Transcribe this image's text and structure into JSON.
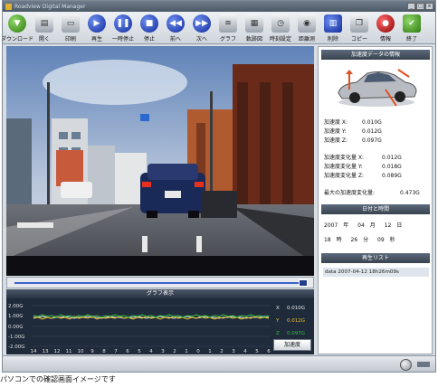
{
  "app": {
    "title": "Roadview Digital Manager"
  },
  "toolbar": {
    "items": [
      {
        "label": "ダウンロード",
        "icon": "download-icon"
      },
      {
        "label": "開く",
        "icon": "open-icon"
      },
      {
        "label": "印刷",
        "icon": "print-icon"
      },
      {
        "label": "再生",
        "icon": "play-icon"
      },
      {
        "label": "一時停止",
        "icon": "pause-icon"
      },
      {
        "label": "停止",
        "icon": "stop-icon"
      },
      {
        "label": "前へ",
        "icon": "previous-icon"
      },
      {
        "label": "次へ",
        "icon": "next-icon"
      },
      {
        "label": "グラフ",
        "icon": "graph-icon"
      },
      {
        "label": "軌跡図",
        "icon": "track-icon"
      },
      {
        "label": "時刻設定",
        "icon": "clock-icon"
      },
      {
        "label": "距離測",
        "icon": "distance-icon"
      },
      {
        "label": "削除",
        "icon": "delete-icon"
      },
      {
        "label": "コピー",
        "icon": "copy-icon"
      },
      {
        "label": "情報",
        "icon": "info-icon"
      },
      {
        "label": "終了",
        "icon": "exit-icon"
      }
    ]
  },
  "graph": {
    "title": "グラフ表示",
    "y_labels": [
      "2.00G",
      "1.00G",
      "0.00G",
      "-1.00G",
      "-2.00G"
    ],
    "x_labels": [
      "14",
      "13",
      "12",
      "11",
      "10",
      "9",
      "8",
      "7",
      "6",
      "5",
      "4",
      "3",
      "2",
      "1",
      "0",
      "1",
      "2",
      "3",
      "4",
      "5",
      "6"
    ],
    "legend": [
      {
        "axis": "X",
        "value": "0.010G",
        "color": "#e8e8e8"
      },
      {
        "axis": "Y",
        "value": "0.012G",
        "color": "#f0c030"
      },
      {
        "axis": "Z",
        "value": "0.097G",
        "color": "#30c040"
      }
    ],
    "button_label": "加速度"
  },
  "sensor": {
    "title": "加速度データの情報",
    "rows": [
      {
        "label": "加速度 X:",
        "value": "0.010G"
      },
      {
        "label": "加速度 Y:",
        "value": "0.012G"
      },
      {
        "label": "加速度 Z:",
        "value": "0.097G"
      }
    ],
    "change_rows": [
      {
        "label": "加速度変化量 X:",
        "value": "0.012G"
      },
      {
        "label": "加速度変化量 Y:",
        "value": "0.018G"
      },
      {
        "label": "加速度変化量 Z:",
        "value": "0.089G"
      }
    ],
    "max_label": "最大の加速度変化量:",
    "max_value": "0.473G"
  },
  "datetime": {
    "title": "日付と時間",
    "year": "2007",
    "year_unit": "年",
    "month": "04",
    "month_unit": "月",
    "day": "12",
    "day_unit": "日",
    "hour": "18",
    "hour_unit": "時",
    "minute": "26",
    "minute_unit": "分",
    "second": "09",
    "second_unit": "秒"
  },
  "playlist": {
    "title": "再生リスト",
    "items": [
      "data 2007-04-12 18h26m09s"
    ]
  },
  "caption": "パソコンでの確認画面イメージです"
}
